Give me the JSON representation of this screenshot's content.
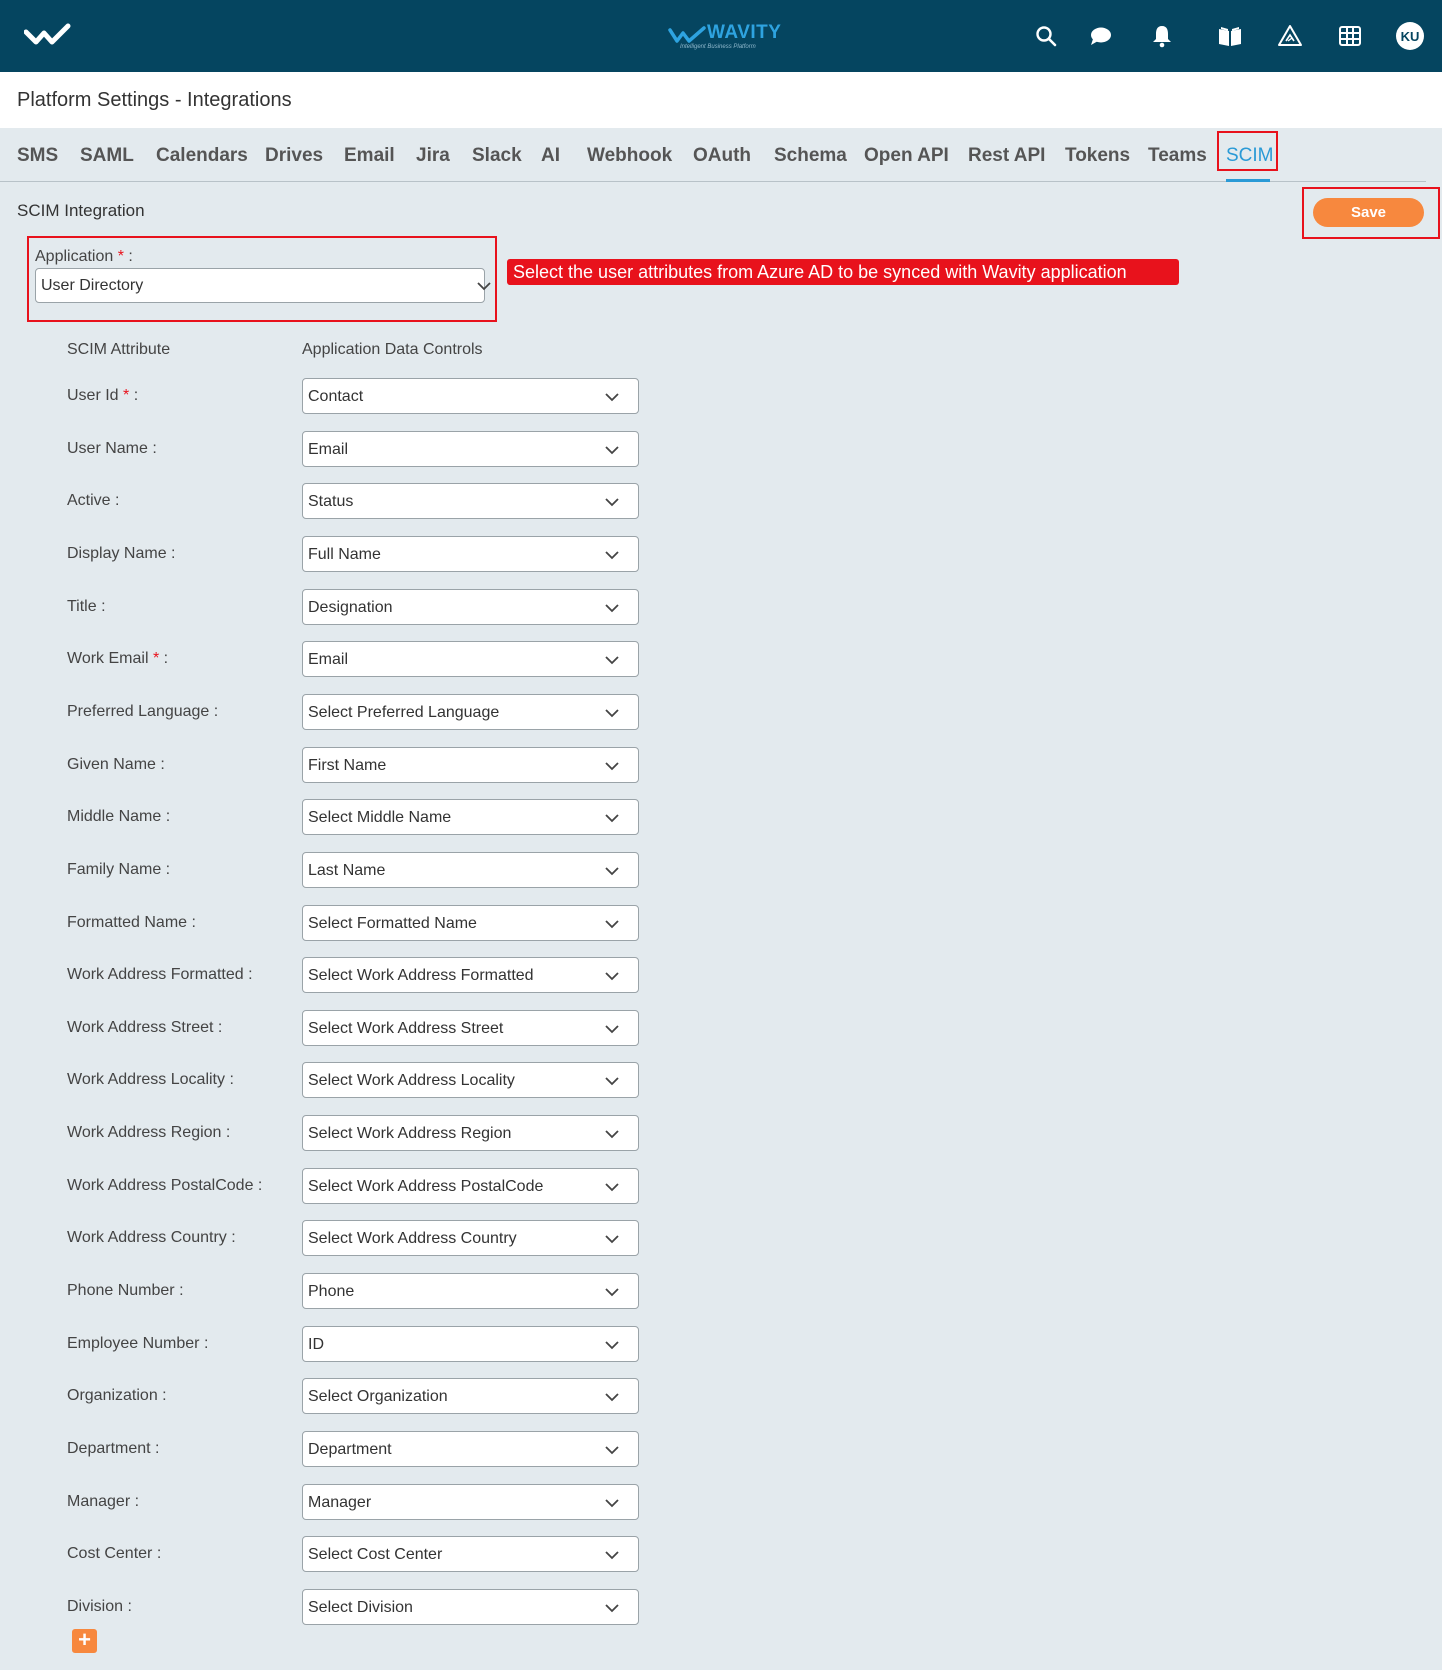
{
  "header": {
    "brand_name": "WAVITY",
    "brand_tagline": "Intelligent Business Platform",
    "avatar_initials": "KU",
    "icons": [
      "search-icon",
      "chat-icon",
      "bell-icon",
      "book-icon",
      "triangle-icon",
      "grid-icon"
    ]
  },
  "page_title": "Platform Settings - Integrations",
  "tabs": [
    "SMS",
    "SAML",
    "Calendars",
    "Drives",
    "Email",
    "Jira",
    "Slack",
    "AI",
    "Webhook",
    "OAuth",
    "Schema",
    "Open API",
    "Rest API",
    "Tokens",
    "Teams",
    "SCIM"
  ],
  "active_tab": "SCIM",
  "section_title": "SCIM Integration",
  "save_label": "Save",
  "application": {
    "label": "Application",
    "required_mark": "*",
    "suffix": " :",
    "value": "User Directory"
  },
  "callout_text": "Select the user attributes from Azure AD to be synced with Wavity application",
  "columns": {
    "attribute": "SCIM Attribute",
    "controls": "Application Data Controls"
  },
  "rows": [
    {
      "label": "User Id",
      "required": true,
      "value": "Contact"
    },
    {
      "label": "User Name",
      "required": false,
      "value": "Email"
    },
    {
      "label": "Active",
      "required": false,
      "value": "Status"
    },
    {
      "label": "Display Name",
      "required": false,
      "value": "Full Name"
    },
    {
      "label": "Title",
      "required": false,
      "value": "Designation"
    },
    {
      "label": "Work Email",
      "required": true,
      "value": "Email"
    },
    {
      "label": "Preferred Language",
      "required": false,
      "value": "Select Preferred Language"
    },
    {
      "label": "Given Name",
      "required": false,
      "value": "First Name"
    },
    {
      "label": "Middle Name",
      "required": false,
      "value": "Select Middle Name"
    },
    {
      "label": "Family Name",
      "required": false,
      "value": "Last Name"
    },
    {
      "label": "Formatted Name",
      "required": false,
      "value": "Select Formatted Name"
    },
    {
      "label": "Work Address Formatted",
      "required": false,
      "value": "Select Work Address Formatted"
    },
    {
      "label": "Work Address Street",
      "required": false,
      "value": "Select Work Address Street"
    },
    {
      "label": "Work Address Locality",
      "required": false,
      "value": "Select Work Address Locality"
    },
    {
      "label": "Work Address Region",
      "required": false,
      "value": "Select Work Address Region"
    },
    {
      "label": "Work Address PostalCode",
      "required": false,
      "value": "Select Work Address PostalCode"
    },
    {
      "label": "Work Address Country",
      "required": false,
      "value": "Select Work Address Country"
    },
    {
      "label": "Phone Number",
      "required": false,
      "value": "Phone"
    },
    {
      "label": "Employee Number",
      "required": false,
      "value": "ID"
    },
    {
      "label": "Organization",
      "required": false,
      "value": "Select Organization"
    },
    {
      "label": "Department",
      "required": false,
      "value": "Department"
    },
    {
      "label": "Manager",
      "required": false,
      "value": "Manager"
    },
    {
      "label": "Cost Center",
      "required": false,
      "value": "Select Cost Center"
    },
    {
      "label": "Division",
      "required": false,
      "value": "Select Division"
    }
  ],
  "add_label": "+",
  "colors": {
    "header_bg": "#054560",
    "page_bg": "#e3eaee",
    "accent_blue": "#2a9ad6",
    "save_orange": "#f7883e",
    "annotation_red": "#e8121c"
  }
}
